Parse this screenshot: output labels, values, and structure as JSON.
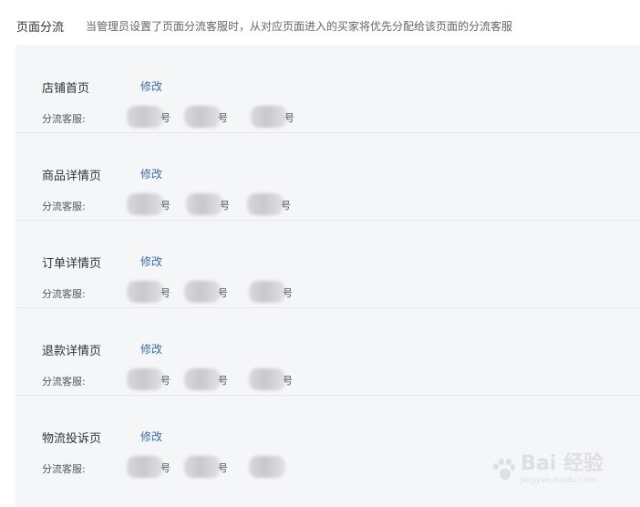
{
  "header": {
    "title": "页面分流",
    "description": "当管理员设置了页面分流客服时，从对应页面进入的买家将优先分配给该页面的分流客服"
  },
  "rows": [
    {
      "title": "店铺首页",
      "edit_label": "修改",
      "agent_label": "分流客服:",
      "agents": [
        {
          "suffix": "号"
        },
        {
          "suffix": "号"
        },
        {
          "suffix": "号"
        }
      ]
    },
    {
      "title": "商品详情页",
      "edit_label": "修改",
      "agent_label": "分流客服:",
      "agents": [
        {
          "suffix": "号"
        },
        {
          "suffix": "号"
        },
        {
          "suffix": "号"
        }
      ]
    },
    {
      "title": "订单详情页",
      "edit_label": "修改",
      "agent_label": "分流客服:",
      "agents": [
        {
          "suffix": "号"
        },
        {
          "suffix": "号"
        },
        {
          "suffix": "号"
        }
      ]
    },
    {
      "title": "退款详情页",
      "edit_label": "修改",
      "agent_label": "分流客服:",
      "agents": [
        {
          "suffix": "号"
        },
        {
          "suffix": "号"
        },
        {
          "suffix": "号"
        }
      ]
    },
    {
      "title": "物流投诉页",
      "edit_label": "修改",
      "agent_label": "分流客服:",
      "agents": [
        {
          "suffix": "号"
        },
        {
          "suffix": "号"
        },
        {
          "suffix": ""
        }
      ]
    }
  ],
  "watermark": {
    "text": "Bai 经验",
    "subtext": "jingyan.baidu.com"
  },
  "colors": {
    "link": "#3a6ea5",
    "panel_bg": "#f5f6f8"
  }
}
